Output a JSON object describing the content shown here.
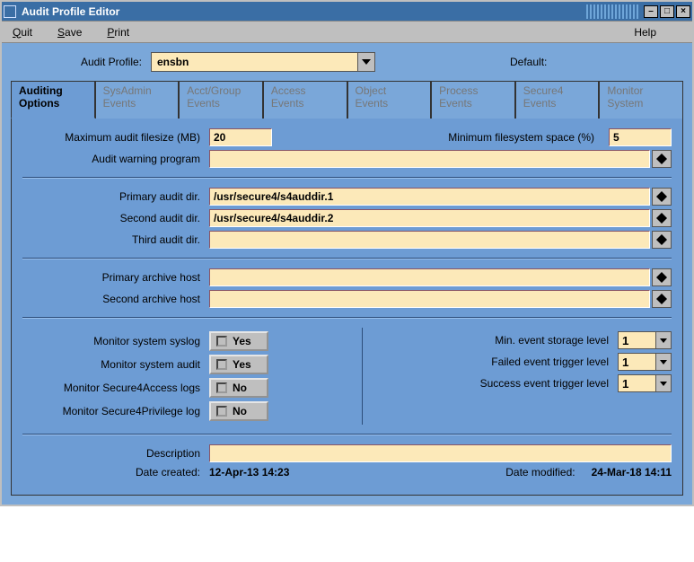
{
  "window": {
    "title": "Audit Profile Editor"
  },
  "menu": {
    "quit": "Quit",
    "save": "Save",
    "print": "Print",
    "help": "Help"
  },
  "profile": {
    "label": "Audit Profile:",
    "value": "ensbn",
    "default_label": "Default:"
  },
  "tabs": [
    {
      "l1": "Auditing",
      "l2": "Options",
      "active": true
    },
    {
      "l1": "SysAdmin",
      "l2": "Events"
    },
    {
      "l1": "Acct/Group",
      "l2": "Events"
    },
    {
      "l1": "Access",
      "l2": "Events"
    },
    {
      "l1": "Object",
      "l2": "Events"
    },
    {
      "l1": "Process",
      "l2": "Events"
    },
    {
      "l1": "Secure4",
      "l2": "Events"
    },
    {
      "l1": "Monitor",
      "l2": "System"
    }
  ],
  "fields": {
    "max_filesize_label": "Maximum audit filesize (MB)",
    "max_filesize_value": "20",
    "min_space_label": "Minimum filesystem space (%)",
    "min_space_value": "5",
    "warning_prog_label": "Audit warning program",
    "warning_prog_value": "",
    "primary_dir_label": "Primary audit dir.",
    "primary_dir_value": "/usr/secure4/s4auddir.1",
    "second_dir_label": "Second audit dir.",
    "second_dir_value": "/usr/secure4/s4auddir.2",
    "third_dir_label": "Third audit dir.",
    "third_dir_value": "",
    "primary_host_label": "Primary archive host",
    "primary_host_value": "",
    "second_host_label": "Second archive host",
    "second_host_value": "",
    "mon_syslog_label": "Monitor system syslog",
    "mon_syslog_value": "Yes",
    "mon_audit_label": "Monitor system audit",
    "mon_audit_value": "Yes",
    "mon_s4access_label": "Monitor Secure4Access logs",
    "mon_s4access_value": "No",
    "mon_s4priv_label": "Monitor Secure4Privilege log",
    "mon_s4priv_value": "No",
    "min_event_label": "Min. event storage level",
    "min_event_value": "1",
    "fail_trig_label": "Failed event trigger level",
    "fail_trig_value": "1",
    "succ_trig_label": "Success event trigger level",
    "succ_trig_value": "1",
    "desc_label": "Description",
    "desc_value": "",
    "date_created_label": "Date created:",
    "date_created_value": "12-Apr-13 14:23",
    "date_modified_label": "Date modified:",
    "date_modified_value": "24-Mar-18 14:11"
  }
}
